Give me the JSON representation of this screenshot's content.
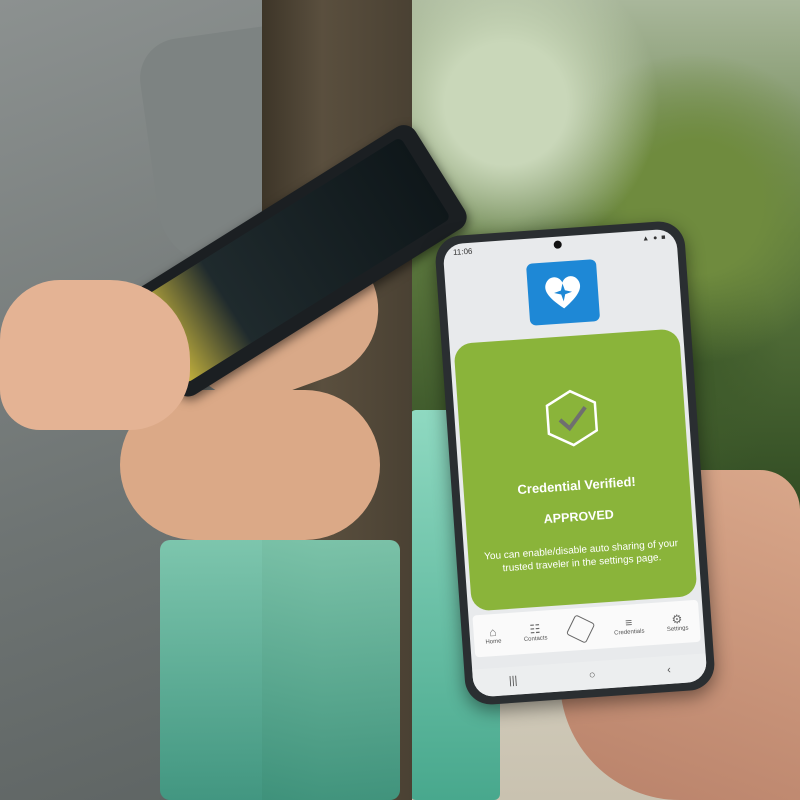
{
  "phone": {
    "status_time": "11:06",
    "status_icons": "▲ ● ■",
    "app_logo_icon": "heart-star-icon",
    "card": {
      "icon": "hexagon-check-icon",
      "title": "Credential Verified!",
      "status": "APPROVED",
      "message": "You can enable/disable auto sharing of your trusted traveler in the settings page.",
      "background_color": "#8ab43a"
    },
    "nav": [
      {
        "label": "Home",
        "icon": "home-icon",
        "glyph": "⌂"
      },
      {
        "label": "Contacts",
        "icon": "contacts-icon",
        "glyph": "☷"
      },
      {
        "label": "",
        "icon": "scan-icon",
        "glyph": ""
      },
      {
        "label": "Credentials",
        "icon": "credentials-icon",
        "glyph": "≡"
      },
      {
        "label": "Settings",
        "icon": "gear-icon",
        "glyph": "⚙"
      }
    ],
    "system_nav": {
      "recent": "|||",
      "home": "○",
      "back": "‹"
    }
  },
  "colors": {
    "accent": "#1e88d6",
    "card": "#8ab43a"
  }
}
